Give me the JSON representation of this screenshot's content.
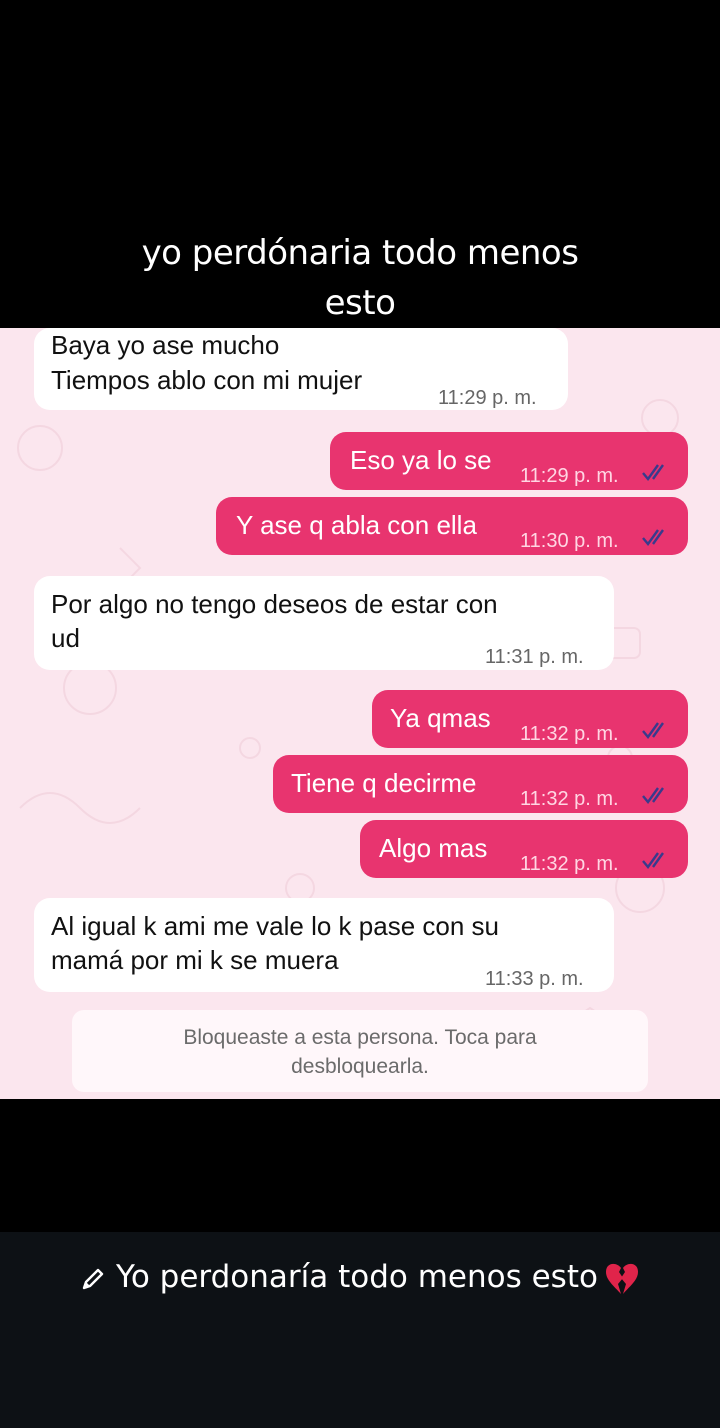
{
  "overlay": {
    "line1": "yo perdónaria todo menos",
    "line2": "esto"
  },
  "messages": [
    {
      "dir": "in",
      "text1": "Baya yo ase mucho",
      "text2": "Tiempos ablo con mi mujer",
      "time": "11:29 p. m."
    },
    {
      "dir": "out",
      "text": "Eso ya lo se",
      "time": "11:29 p. m.",
      "status": "read-ticks-icon"
    },
    {
      "dir": "out",
      "text": "Y ase q abla con ella",
      "time": "11:30 p. m.",
      "status": "read-ticks-icon"
    },
    {
      "dir": "in",
      "text1": "Por algo no tengo deseos de estar con",
      "text2": "ud",
      "time": "11:31 p. m."
    },
    {
      "dir": "out",
      "text": "Ya qmas",
      "time": "11:32 p. m.",
      "status": "read-ticks-icon"
    },
    {
      "dir": "out",
      "text": "Tiene q decirme",
      "time": "11:32 p. m.",
      "status": "read-ticks-icon"
    },
    {
      "dir": "out",
      "text": "Algo mas",
      "time": "11:32 p. m.",
      "status": "read-ticks-icon"
    },
    {
      "dir": "in",
      "text1": "Al igual k ami me vale lo k pase con su",
      "text2": "mamá por mi k se muera",
      "time": "11:33 p. m."
    }
  ],
  "blocked_notice": {
    "line1": "Bloqueaste a esta persona. Toca para",
    "line2": "desbloquearla."
  },
  "caption": {
    "text": "Yo perdonaría todo menos esto",
    "leading_icon": "pencil-icon",
    "trailing_icon": "broken-heart-icon"
  },
  "colors": {
    "outgoing": "#e8346f",
    "incoming": "#ffffff",
    "chat_bg": "#fbe6ee",
    "ticks": "#3a3a8c"
  }
}
